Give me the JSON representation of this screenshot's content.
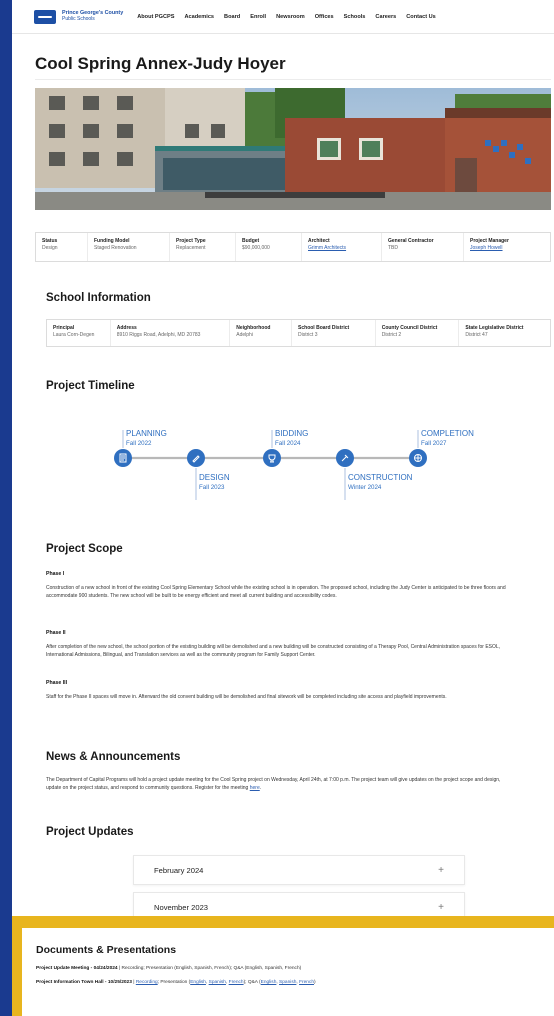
{
  "nav": {
    "logo_title": "Prince George's County",
    "logo_sub": "Public Schools",
    "links": [
      "About PGCPS",
      "Academics",
      "Board",
      "Enroll",
      "Newsroom",
      "Offices",
      "Schools",
      "Careers",
      "Contact Us"
    ]
  },
  "page_title": "Cool Spring Annex-Judy Hoyer",
  "project_table": [
    {
      "label": "Status",
      "value": "Design"
    },
    {
      "label": "Funding Model",
      "value": "Staged Renovation"
    },
    {
      "label": "Project Type",
      "value": "Replacement"
    },
    {
      "label": "Budget",
      "value": "$90,000,000"
    },
    {
      "label": "Architect",
      "value": "Grimm Architects"
    },
    {
      "label": "General Contractor",
      "value": "TBD"
    },
    {
      "label": "Project Manager",
      "value": "Joseph Howell"
    }
  ],
  "school_info": {
    "heading": "School Information",
    "cells": [
      {
        "label": "Principal",
        "value": "Laura Corn-Degen"
      },
      {
        "label": "Address",
        "value": "8910 Riggs Road, Adelphi, MD 20783"
      },
      {
        "label": "Neighborhood",
        "value": "Adelphi"
      },
      {
        "label": "School Board District",
        "value": "District 3"
      },
      {
        "label": "County Council District",
        "value": "District 2"
      },
      {
        "label": "State Legislative District",
        "value": "District 47"
      }
    ]
  },
  "timeline": {
    "heading": "Project Timeline",
    "phases": [
      {
        "name": "PLANNING",
        "date": "Fall 2022",
        "icon": "clipboard-icon",
        "position": "above"
      },
      {
        "name": "DESIGN",
        "date": "Fall 2023",
        "icon": "pencil-icon",
        "position": "below"
      },
      {
        "name": "BIDDING",
        "date": "Fall 2024",
        "icon": "trophy-icon",
        "position": "above"
      },
      {
        "name": "CONSTRUCTION",
        "date": "Winter 2024",
        "icon": "hammer-icon",
        "position": "below"
      },
      {
        "name": "COMPLETION",
        "date": "Fall 2027",
        "icon": "globe-icon",
        "position": "above"
      }
    ],
    "accent": "#2f6fc0"
  },
  "scope": {
    "heading": "Project Scope",
    "phases": [
      {
        "title": "Phase I",
        "text": "Construction of a new school in front of the existing Cool Spring Elementary School while the existing school is in operation. The proposed school, including the Judy Center is anticipated to be three floors and accommodate 900 students. The new school will be built to be energy efficient and meet all current building and accessibility codes."
      },
      {
        "title": "Phase II",
        "text": "After completion of the new school, the school portion of the existing building will be demolished and a new building will be constructed consisting of a Therapy Pool, Central Administration spaces for ESOL, International Admissions, Bilingual, and Translation services as well as the community program for Family Support Center."
      },
      {
        "title": "Phase III",
        "text": "Staff for the Phase II spaces will move in. Afterward the old convent building will be demolished and final sitework will be completed including site access and playfield improvements."
      }
    ]
  },
  "news": {
    "heading": "News & Announcements",
    "text": "The Department of Capital Programs will hold a project update meeting for the Cool Spring project on Wednesday, April 24th, at 7:00 p.m. The project team will give updates on the project scope and design, update on the project status, and respond to community questions. Register for the meeting",
    "link": "here",
    "end": "."
  },
  "updates": {
    "heading": "Project Updates",
    "items": [
      {
        "label": "February 2024",
        "plus": "+"
      },
      {
        "label": "November 2023",
        "plus": "+"
      }
    ]
  },
  "documents": {
    "heading": "Documents & Presentations",
    "line1": {
      "title": "Project Update Meeting - 04/24/2024",
      "rest": "| Recording; Presentation (English, Spanish, French); Q&A (English, Spanish, French)"
    },
    "line2": {
      "title": "Project Information Town Hall - 10/25/2023",
      "sep": "|",
      "recording": "Recording",
      "pres": "; Presentation (",
      "en": "English",
      "c1": ", ",
      "es": "Spanish",
      "c2": ", ",
      "fr": "French",
      "qa": "); Q&A (",
      "en2": "English",
      "c3": ", ",
      "es2": "Spanish",
      "c4": ", ",
      "fr2": "French",
      "end": ")"
    }
  }
}
